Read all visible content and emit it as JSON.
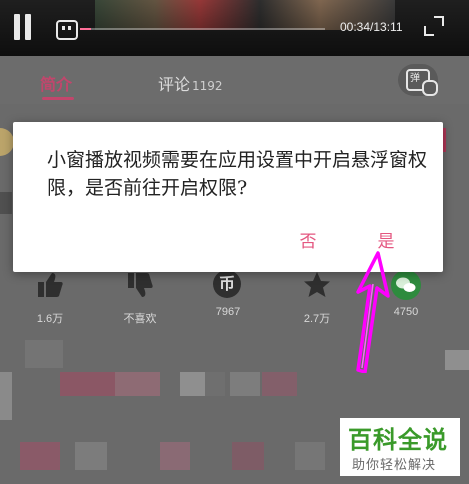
{
  "video": {
    "time": "00:34/13:11",
    "progress_fraction": 0.043
  },
  "tabs": {
    "intro_label": "简介",
    "comments_label": "评论",
    "comments_count": "1192",
    "danmaku_glyph": "弹"
  },
  "actions": [
    {
      "label": "1.6万"
    },
    {
      "label": "不喜欢"
    },
    {
      "label": "7967"
    },
    {
      "label": "2.7万"
    },
    {
      "label": "4750"
    }
  ],
  "coin_glyph": "币",
  "dialog": {
    "message": "小窗播放视频需要在应用设置中开启悬浮窗权限，是否前往开启权限?",
    "no_label": "否",
    "yes_label": "是"
  },
  "watermark": {
    "title": "百科全说",
    "subtitle": "助你轻松解决"
  },
  "colors": {
    "accent": "#e45780",
    "tab_active": "#c2466c",
    "arrow": "#ff00ff",
    "watermark_green": "#3a9a2a"
  }
}
